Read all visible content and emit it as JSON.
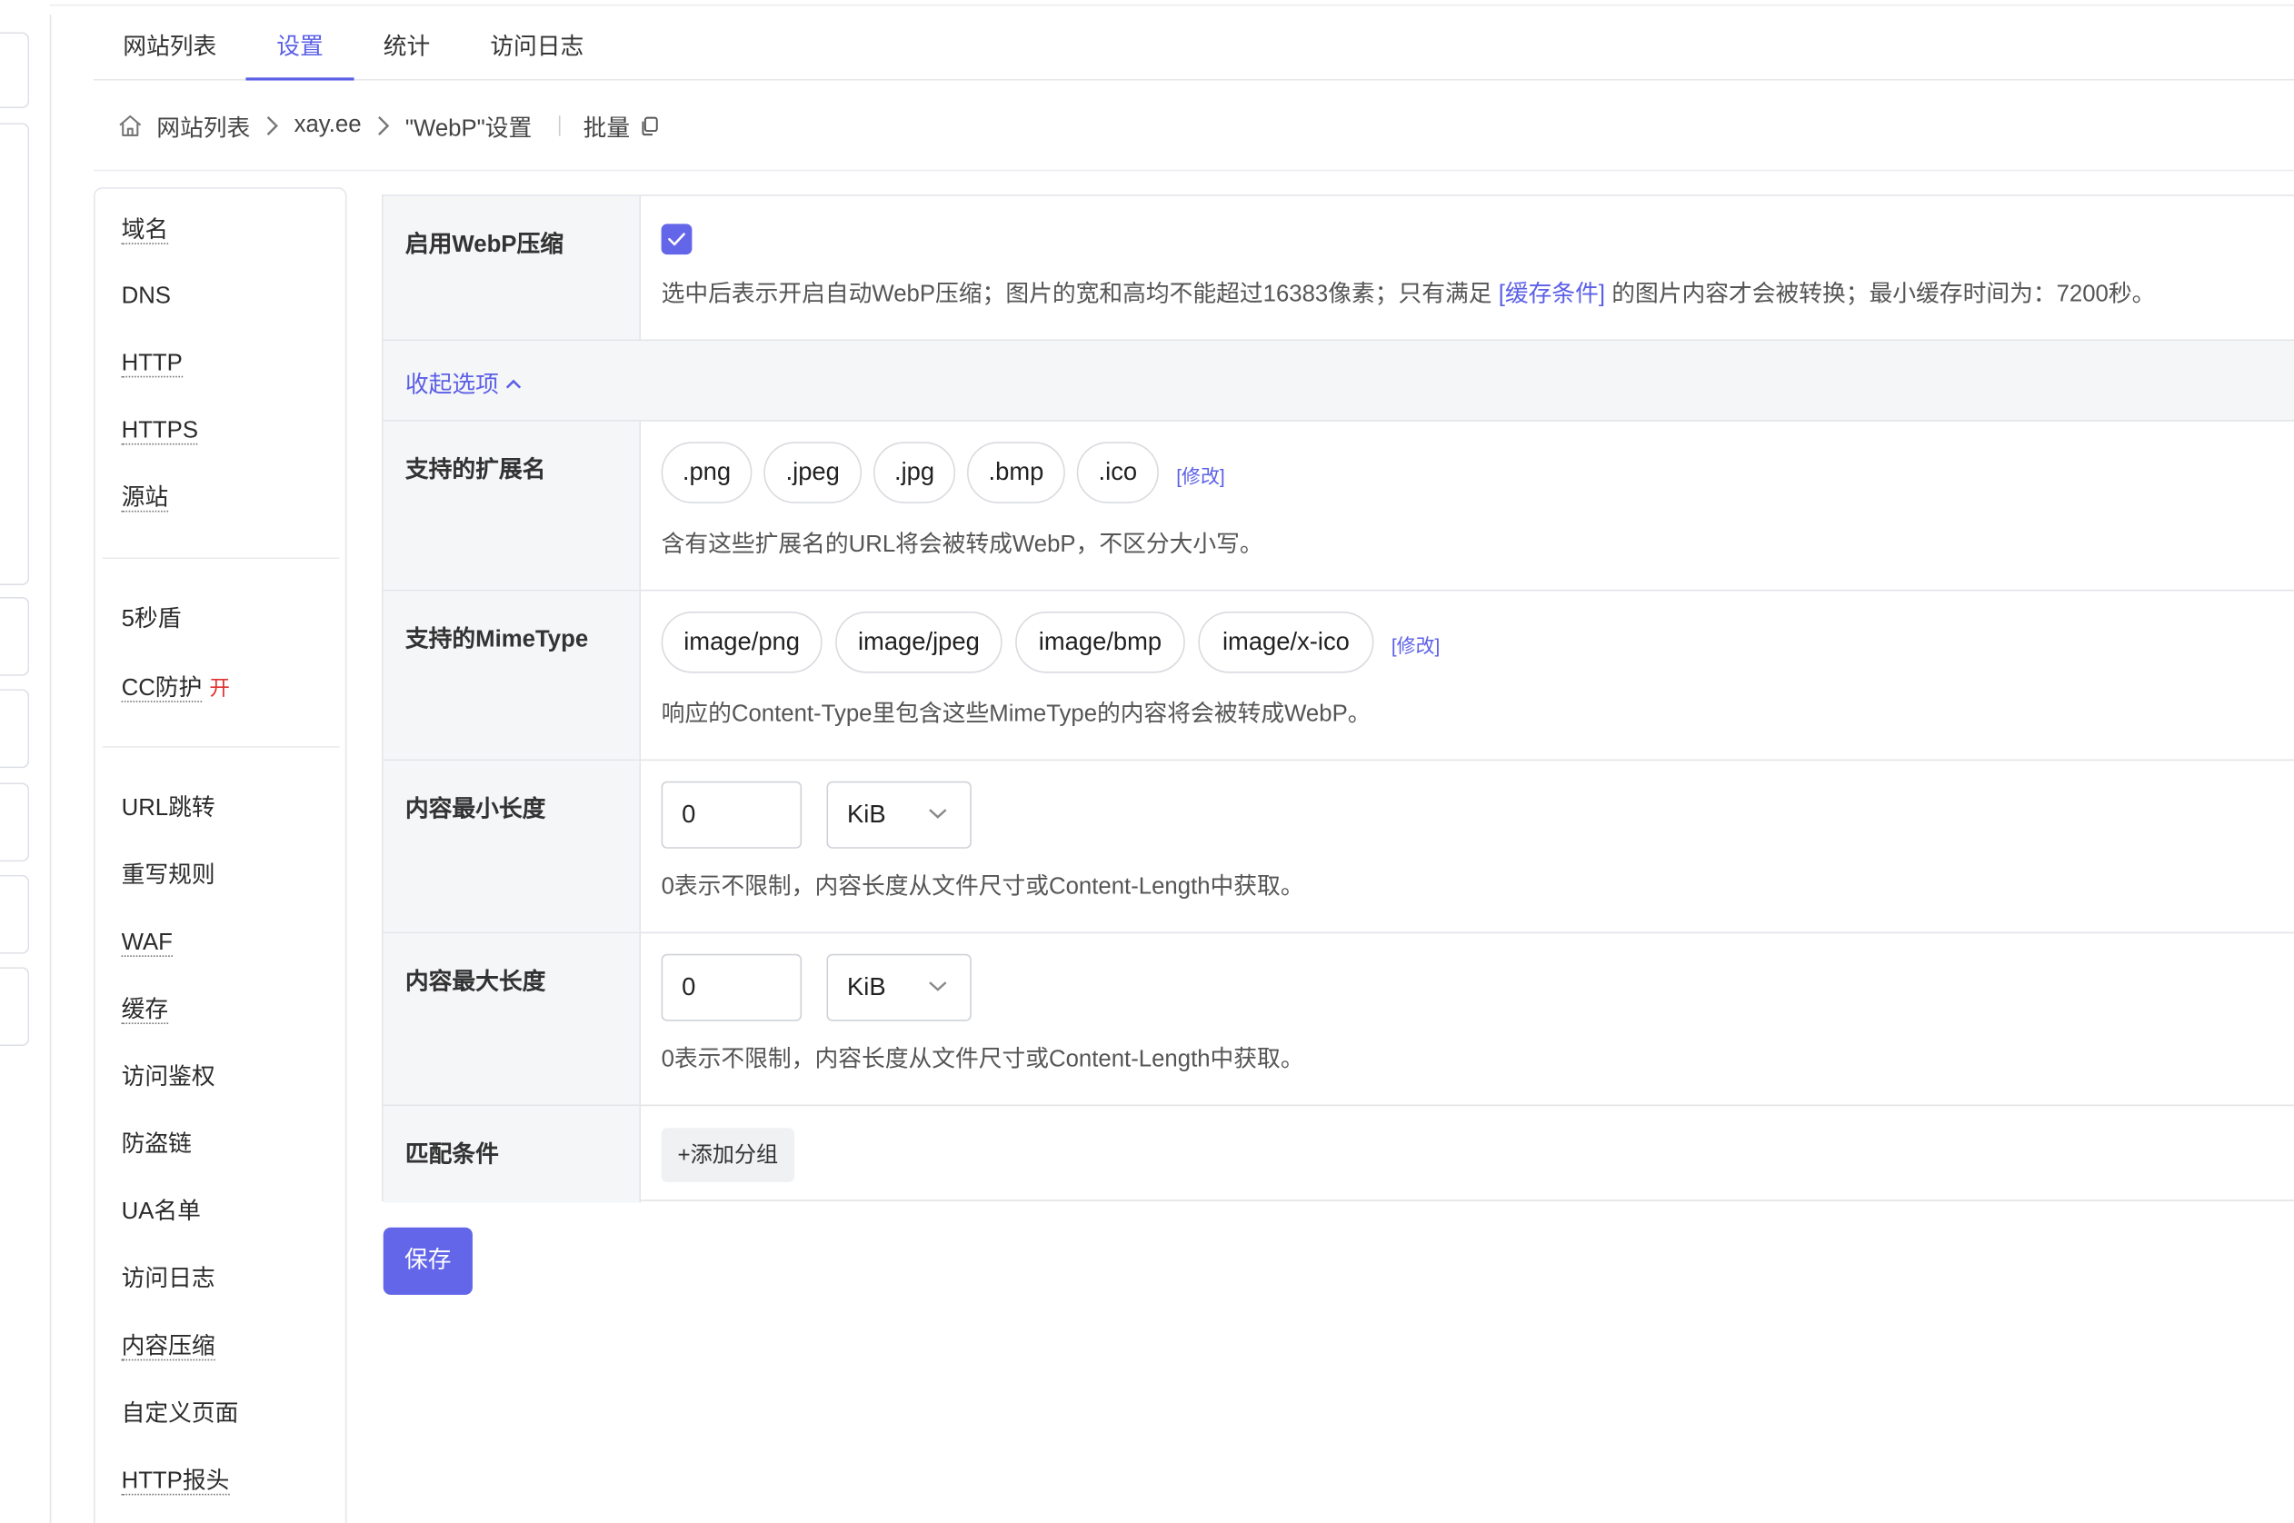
{
  "tabs": [
    "网站列表",
    "设置",
    "统计",
    "访问日志"
  ],
  "active_tab": "设置",
  "breadcrumb": {
    "items": [
      "网站列表",
      "xay.ee",
      "\"WebP\"设置"
    ],
    "batch_label": "批量"
  },
  "menu": {
    "group1": [
      "域名",
      "DNS",
      "HTTP",
      "HTTPS",
      "源站"
    ],
    "group2": [
      "5秒盾",
      "CC防护"
    ],
    "cc_badge": "开",
    "group3": [
      "URL跳转",
      "重写规则",
      "WAF",
      "缓存",
      "访问鉴权",
      "防盗链",
      "UA名单",
      "访问日志",
      "内容压缩",
      "自定义页面",
      "HTTP报头"
    ]
  },
  "form": {
    "enable": {
      "label": "启用WebP压缩",
      "checked": true,
      "help_before": "选中后表示开启自动WebP压缩；图片的宽和高均不能超过16383像素；只有满足",
      "help_link": "[缓存条件]",
      "help_after": "的图片内容才会被转换；最小缓存时间为：7200秒。"
    },
    "collapse_label": "收起选项",
    "extensions": {
      "label": "支持的扩展名",
      "values": [
        ".png",
        ".jpeg",
        ".jpg",
        ".bmp",
        ".ico"
      ],
      "modify": "[修改]",
      "help": "含有这些扩展名的URL将会被转成WebP，不区分大小写。"
    },
    "mimetypes": {
      "label": "支持的MimeType",
      "values": [
        "image/png",
        "image/jpeg",
        "image/bmp",
        "image/x-ico"
      ],
      "modify": "[修改]",
      "help": "响应的Content-Type里包含这些MimeType的内容将会被转成WebP。"
    },
    "min_length": {
      "label": "内容最小长度",
      "value": "0",
      "unit": "KiB",
      "help": "0表示不限制，内容长度从文件尺寸或Content-Length中获取。"
    },
    "max_length": {
      "label": "内容最大长度",
      "value": "0",
      "unit": "KiB",
      "help": "0表示不限制，内容长度从文件尺寸或Content-Length中获取。"
    },
    "conditions": {
      "label": "匹配条件",
      "add_group": "+添加分组"
    }
  },
  "save_label": "保存",
  "colors": {
    "accent": "#5b5fe6",
    "checkbox": "#6366e8",
    "badge": "#e03030"
  }
}
